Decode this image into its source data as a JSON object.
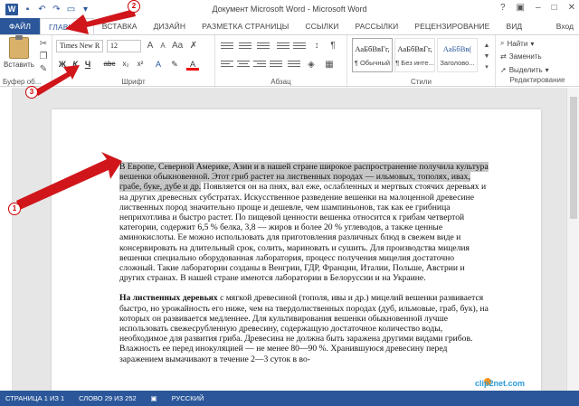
{
  "window": {
    "title": "Документ Microsoft Word - Microsoft Word",
    "app_icon": "W",
    "controls": [
      "?",
      "▣",
      "–",
      "□",
      "✕"
    ]
  },
  "tabs": [
    "ФАЙЛ",
    "ГЛАВНАЯ",
    "ВСТАВКА",
    "ДИЗАЙН",
    "РАЗМЕТКА СТРАНИЦЫ",
    "ССЫЛКИ",
    "РАССЫЛКИ",
    "РЕЦЕНЗИРОВАНИЕ",
    "ВИД"
  ],
  "user": "Вход",
  "ribbon": {
    "clipboard": {
      "paste": "Вставить",
      "label": "Буфер об..."
    },
    "font": {
      "name": "Times New R",
      "size": "12",
      "bold": "Ж",
      "italic": "К",
      "underline": "Ч",
      "strike": "abc",
      "sub": "x₂",
      "sup": "x²",
      "label": "Шрифт"
    },
    "paragraph": {
      "label": "Абзац"
    },
    "styles": {
      "items": [
        {
          "preview": "АаБбВвГг,",
          "name": "¶ Обычный"
        },
        {
          "preview": "АаБбВвГг,",
          "name": "¶ Без инте..."
        },
        {
          "preview": "АаБбВв(",
          "name": "Заголово..."
        }
      ],
      "label": "Стили"
    },
    "editing": {
      "find": "Найти",
      "replace": "Заменить",
      "select": "Выделить",
      "label": "Редактирование"
    }
  },
  "document": {
    "p1_highlighted": "В Европе, Северной Америке, Азии и в нашей стране широкое распространение получила культура вешенки обыкновенной. Этот гриб растет на лиственных породах — ильмовых, тополях, ивах, грабе, буке, дубе и др.",
    "p1_rest": " Появляется он на пнях, вал еже, ослабленных и мертвых стоячих деревьях и на других древесных субстратах. Искусственное разведение вешенки на малоценной древесине лиственных пород значительно проще и дешевле, чем шампиньонов, так как ее грибница неприхотлива и быстро растет. По пищевой ценности вешенка относится к грибам четвертой категории, содержит 6,5 % белка, 3,8 — жиров и более 20 % углеводов, а также ценные аминокислоты. Ее можно использовать для приготовления различных блюд в свежем виде и консервировать на длительный срок, солить, мариновать и сушить. Для производства мицелия вешенки специально оборудованная лаборатория, процесс получения мицелия достаточно сложный. Такие лаборатории созданы в Венгрии, ГДР, Франции, Италии, Польше, Австрии и других странах. В нашей стране имеются лаборатории в Белоруссии и на Украине.",
    "p2_bold": "На лиственных деревьях",
    "p2_rest": " с мягкой древесиной (тополя, ивы и др.) мицелий вешенки развивается быстро, но урожайность его ниже, чем на твердолиственных породах (дуб, ильмовые, граб, бук), на которых он развивается медленнее. Для культивирования вешенки обыкновенной лучше использовать свежесрубленную древесину, содержащую достаточное количество воды, необходимое для развития гриба. Древесина не должна быть заражена другими видами грибов. Влажность ее перед инокуляцией — не менее 80—90 %. Хранившуюся древесину перед заражением вымачивают в течение 2—3 суток в во-"
  },
  "status": {
    "page": "СТРАНИЦА 1 ИЗ 1",
    "words": "СЛОВО 29 ИЗ 252",
    "lang": "РУССКИЙ"
  },
  "callouts": [
    "1",
    "2",
    "3"
  ],
  "watermark": "clip2net.com",
  "colors": {
    "accent": "#2b579a",
    "arrow": "#d0161b",
    "highlight": "#c6c6c6"
  }
}
